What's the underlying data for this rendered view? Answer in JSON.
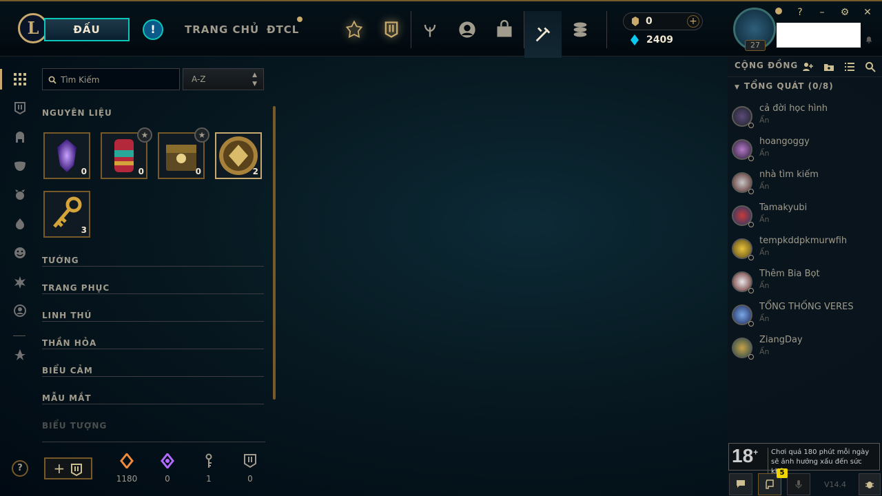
{
  "topbar": {
    "play_label": "ĐẤU",
    "alert_symbol": "!",
    "home_label": "TRANG CHỦ",
    "tft_label": "ĐTCL",
    "nav_icons": [
      "ranked-icon",
      "collection-icon",
      "clash-icon",
      "profile-icon",
      "store-icon",
      "loot-icon",
      "currency-icon"
    ],
    "active_nav": "loot-icon"
  },
  "wallet": {
    "rp": "0",
    "be": "2409",
    "add_symbol": "+"
  },
  "profile": {
    "level": "27"
  },
  "window_controls": {
    "help": "?",
    "minimize": "–",
    "settings": "⚙",
    "close": "✕"
  },
  "loot": {
    "search_placeholder": "Tìm Kiếm",
    "sort_value": "A-Z",
    "materials_title": "NGUYÊN LIỆU",
    "items": [
      {
        "name": "essence-crystal",
        "qty": "0"
      },
      {
        "name": "chest-red",
        "qty": "0"
      },
      {
        "name": "chest-gold",
        "qty": "0"
      },
      {
        "name": "token-gold",
        "qty": "2"
      },
      {
        "name": "hextech-key",
        "qty": "3"
      }
    ],
    "categories": [
      "TƯỚNG",
      "TRANG PHỤC",
      "LINH THÚ",
      "THẦN HỎA",
      "BIỂU CẢM",
      "MẪU MẮT",
      "BIỂU TƯỢNG"
    ]
  },
  "footer_currencies": [
    {
      "icon": "orange-essence-icon",
      "value": "1180",
      "color": "#f08a3c"
    },
    {
      "icon": "mythic-essence-icon",
      "value": "0",
      "color": "#b26bff"
    },
    {
      "icon": "key-fragment-icon",
      "value": "1",
      "color": "#a09b8c"
    },
    {
      "icon": "chest-token-icon",
      "value": "0",
      "color": "#a09b8c"
    }
  ],
  "social": {
    "title": "CỘNG ĐỒNG",
    "group_label": "TỔNG QUÁT (0/8)",
    "friends": [
      {
        "name": "cả đời học hình",
        "status": "Ẩn"
      },
      {
        "name": "hoangoggy",
        "status": "Ẩn"
      },
      {
        "name": "nhà tìm kiếm",
        "status": "Ẩn"
      },
      {
        "name": "Tamakyubi",
        "status": "Ẩn"
      },
      {
        "name": "tempkddpkmurwfih",
        "status": "Ẩn"
      },
      {
        "name": "Thêm Bia Bọt",
        "status": "Ẩn"
      },
      {
        "name": "TỔNG THỐNG VERES",
        "status": "Ẩn"
      },
      {
        "name": "ZiangDay",
        "status": "Ẩn"
      }
    ]
  },
  "warning": {
    "age": "18",
    "plus": "+",
    "line1": "Chơi quá 180 phút mỗi ngày",
    "line2": "sẽ ảnh hưởng xấu đến sức khỏe"
  },
  "bottom": {
    "mission_badge": "5",
    "version": "V14.4"
  },
  "colors": {
    "gold": "#c8aa6e",
    "teal": "#0ac8b9",
    "dark": "#010a13"
  }
}
